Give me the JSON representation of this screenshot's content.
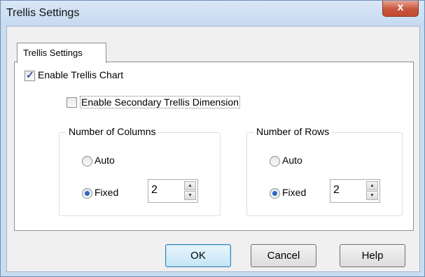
{
  "window": {
    "title": "Trellis Settings",
    "close_glyph": "x"
  },
  "tab": {
    "label": "Trellis Settings"
  },
  "enable_trellis": {
    "label": "Enable Trellis Chart",
    "checked": true
  },
  "enable_secondary": {
    "label": "Enable Secondary Trellis Dimension",
    "checked": false
  },
  "columns": {
    "legend": "Number of Columns",
    "auto_label": "Auto",
    "fixed_label": "Fixed",
    "selected": "fixed",
    "value": "2"
  },
  "rows": {
    "legend": "Number of Rows",
    "auto_label": "Auto",
    "fixed_label": "Fixed",
    "selected": "fixed",
    "value": "2"
  },
  "buttons": {
    "ok": "OK",
    "cancel": "Cancel",
    "help": "Help"
  },
  "colors": {
    "accent": "#2b66c7",
    "close_red": "#c9553d"
  }
}
